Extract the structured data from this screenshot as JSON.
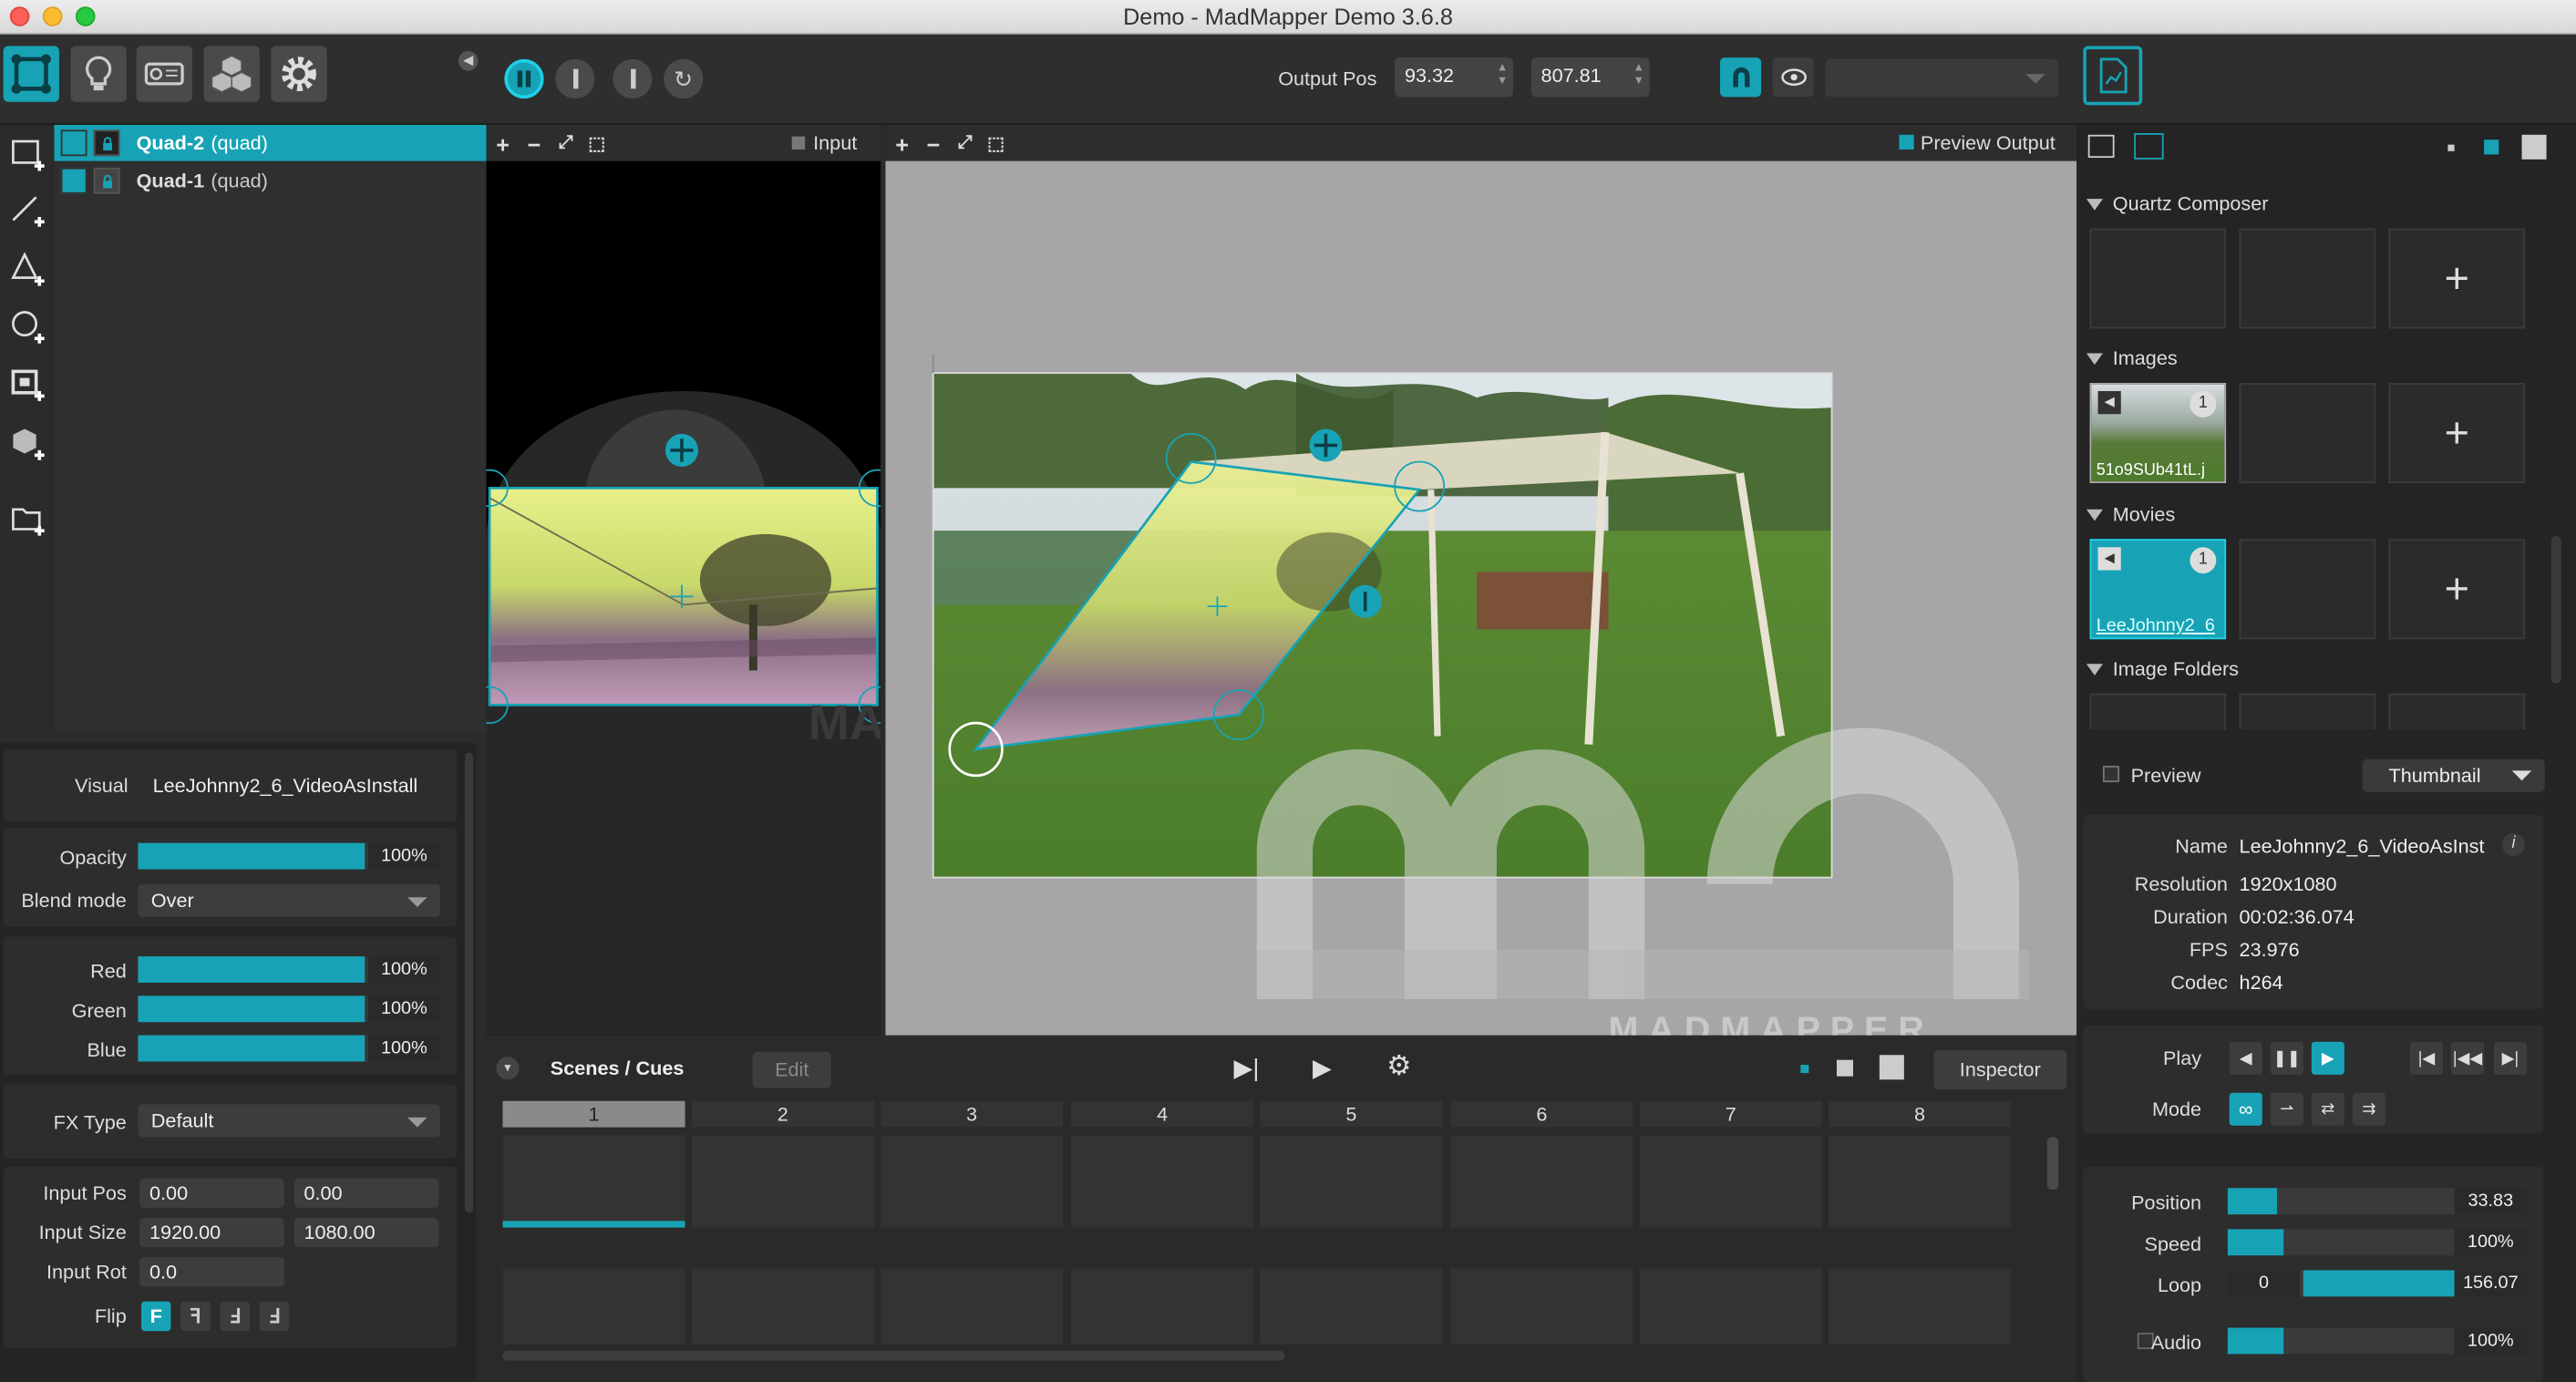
{
  "window": {
    "title": "Demo - MadMapper Demo 3.6.8"
  },
  "toolbar": {
    "output_pos_label": "Output Pos",
    "output_pos_x": "93.32",
    "output_pos_y": "807.81",
    "output_dropdown": ""
  },
  "layers": [
    {
      "name": "Quad-2",
      "type": "(quad)",
      "selected": true
    },
    {
      "name": "Quad-1",
      "type": "(quad)",
      "selected": false
    }
  ],
  "inspector": {
    "visual_label": "Visual",
    "visual_value": "LeeJohnny2_6_VideoAsInstall",
    "opacity_label": "Opacity",
    "opacity_value": "100%",
    "opacity_level": 1.0,
    "blend_label": "Blend mode",
    "blend_value": "Over",
    "red_label": "Red",
    "red_value": "100%",
    "green_label": "Green",
    "green_value": "100%",
    "blue_label": "Blue",
    "blue_value": "100%",
    "fx_label": "FX Type",
    "fx_value": "Default",
    "input_pos_label": "Input Pos",
    "input_pos_x": "0.00",
    "input_pos_y": "0.00",
    "input_size_label": "Input Size",
    "input_size_w": "1920.00",
    "input_size_h": "1080.00",
    "input_rot_label": "Input Rot",
    "input_rot_value": "0.0",
    "flip_label": "Flip",
    "flip_options": [
      "F",
      "ꟻ",
      "Ⅎ",
      "ꓞ"
    ]
  },
  "input_view": {
    "label": "Input"
  },
  "output_view": {
    "label": "Preview Output",
    "watermark_small": "MADMAPPER",
    "watermark_ma": "MA"
  },
  "scenes": {
    "title": "Scenes / Cues",
    "edit_label": "Edit",
    "inspector_label": "Inspector",
    "columns": [
      "1",
      "2",
      "3",
      "4",
      "5",
      "6",
      "7",
      "8"
    ]
  },
  "media": {
    "quartz_label": "Quartz Composer",
    "images_label": "Images",
    "image_item": "51o9SUb41tL.j",
    "image_count": "1",
    "movies_label": "Movies",
    "movie_item": "LeeJohnny2_6",
    "movie_count": "1",
    "folders_label": "Image Folders"
  },
  "media_info": {
    "preview_label": "Preview",
    "thumbnail_label": "Thumbnail",
    "name_label": "Name",
    "name_value": "LeeJohnny2_6_VideoAsInst",
    "resolution_label": "Resolution",
    "resolution_value": "1920x1080",
    "duration_label": "Duration",
    "duration_value": "00:02:36.074",
    "fps_label": "FPS",
    "fps_value": "23.976",
    "codec_label": "Codec",
    "codec_value": "h264",
    "play_label": "Play",
    "mode_label": "Mode",
    "position_label": "Position",
    "position_value": "33.83",
    "position_level": 0.22,
    "speed_label": "Speed",
    "speed_value": "100%",
    "speed_level": 0.25,
    "loop_label": "Loop",
    "loop_start": "0",
    "loop_end": "156.07",
    "audio_label": "Audio",
    "audio_value": "100%",
    "audio_level": 0.25
  },
  "colors": {
    "accent": "#17a3b5",
    "panel": "#2d2d2d",
    "dark": "#242424"
  }
}
